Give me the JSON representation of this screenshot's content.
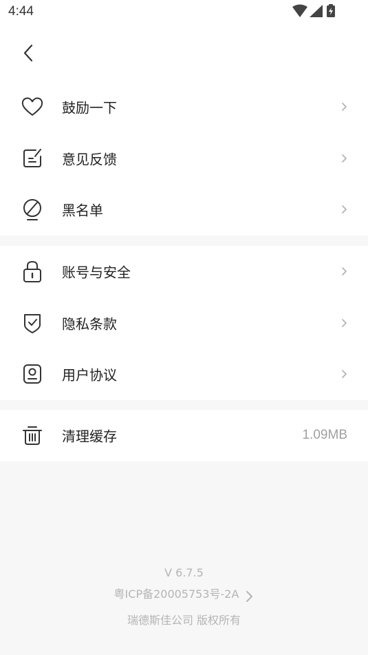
{
  "status_bar": {
    "time": "4:44",
    "icons": [
      "wifi-icon",
      "signal-icon",
      "battery-icon"
    ]
  },
  "header": {
    "back_icon": "chevron-left-icon"
  },
  "groups": [
    {
      "items": [
        {
          "icon": "heart-icon",
          "label": "鼓励一下"
        },
        {
          "icon": "feedback-note-icon",
          "label": "意见反馈"
        },
        {
          "icon": "blocked-icon",
          "label": "黑名单"
        }
      ]
    },
    {
      "items": [
        {
          "icon": "lock-icon",
          "label": "账号与安全"
        },
        {
          "icon": "shield-check-icon",
          "label": "隐私条款"
        },
        {
          "icon": "user-agreement-icon",
          "label": "用户协议"
        }
      ]
    },
    {
      "items": [
        {
          "icon": "trash-icon",
          "label": "清理缓存",
          "value": "1.09MB"
        }
      ]
    }
  ],
  "footer": {
    "version": "V 6.7.5",
    "icp": "粤ICP备20005753号-2A",
    "copyright": "瑞德斯佳公司 版权所有"
  },
  "colors": {
    "background": "#f7f7f7",
    "card": "#ffffff",
    "text_primary": "#222222",
    "text_secondary": "#a0a0a0",
    "chevron": "#b0b0b0"
  }
}
